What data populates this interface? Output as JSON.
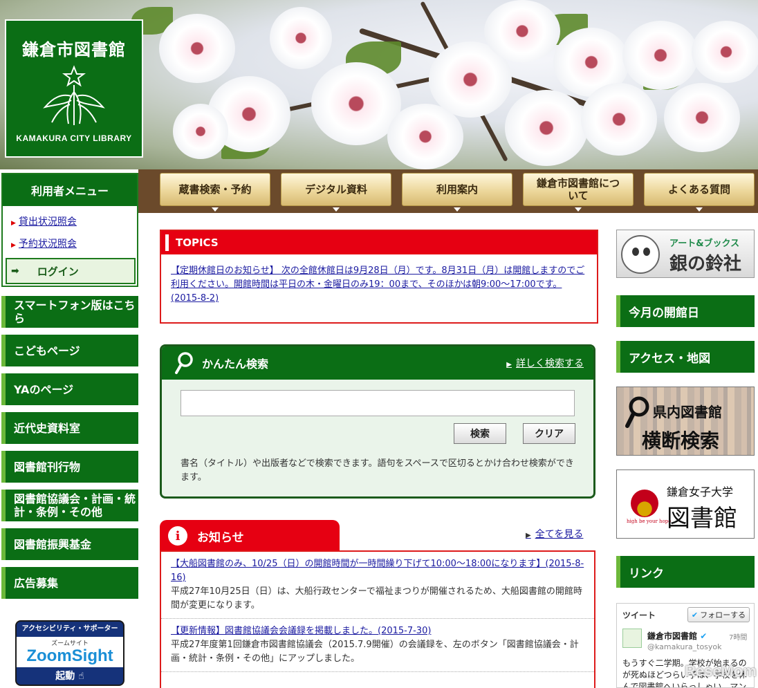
{
  "header": {
    "logo_title": "鎌倉市図書館",
    "logo_subtitle": "KAMAKURA CITY LIBRARY"
  },
  "nav": {
    "items": [
      {
        "label": "蔵書検索・予約"
      },
      {
        "label": "デジタル資料"
      },
      {
        "label": "利用案内"
      },
      {
        "label": "鎌倉市図書館について"
      },
      {
        "label": "よくある質問"
      }
    ]
  },
  "user_menu": {
    "title": "利用者メニュー",
    "links": [
      "貸出状況照会",
      "予約状況照会"
    ],
    "login_label": "ログイン"
  },
  "sidebar": {
    "items": [
      {
        "label": "スマートフォン版はこちら"
      },
      {
        "label": "こどもページ"
      },
      {
        "label": "YAのページ"
      },
      {
        "label": "近代史資料室"
      },
      {
        "label": "図書館刊行物"
      },
      {
        "label": "図書館協議会・計画・統計・条例・その他"
      },
      {
        "label": "図書館振興基金"
      },
      {
        "label": "広告募集"
      }
    ]
  },
  "zoomsight": {
    "top": "アクセシビリティ・サポーター",
    "small": "ズームサイト",
    "logo": "ZoomSight",
    "start": "起動"
  },
  "topics": {
    "title": "TOPICS",
    "body": "【定期休館日のお知らせ】 次の全館休館日は9月28日（月）です。8月31日（月）は開館しますのでご利用ください。開館時間は平日の木・金曜日のみ19：00まで、そのほかは朝9:00～17:00です。(2015-8-2)"
  },
  "search": {
    "title": "かんたん検索",
    "advanced_link": "詳しく検索する",
    "input_value": "",
    "search_button": "検索",
    "clear_button": "クリア",
    "help": "書名（タイトル）や出版者などで検索できます。語句をスペースで区切るとかけ合わせ検索ができます。"
  },
  "notices": {
    "title": "お知らせ",
    "icon_char": "i",
    "see_all": "全てを見る",
    "items": [
      {
        "link": "【大船図書館のみ、10/25（日）の開館時間が一時間繰り下げて10:00～18:00になります】(2015-8-16)",
        "text": "平成27年10月25日（日）は、大船行政センターで福祉まつりが開催されるため、大船図書館の開館時間が変更になります。"
      },
      {
        "link": "【更新情報】図書館協議会会議録を掲載しました。(2015-7-30)",
        "text": "平成27年度第1回鎌倉市図書館協議会（2015.7.9開催）の会議録を、左のボタン「図書館協議会・計画・統計・条例・その他」にアップしました。"
      }
    ]
  },
  "right": {
    "ginnosuzu_top": "アート&ブックス",
    "ginnosuzu_main": "銀の鈴社",
    "items": [
      {
        "label": "今月の開館日"
      },
      {
        "label": "アクセス・地図"
      }
    ],
    "kennai_top": "県内図書館",
    "kennai_main": "横断検索",
    "joshi_top": "鎌倉女子大学",
    "joshi_main": "図書館",
    "joshi_motto": "high be your hope",
    "link_label": "リンク"
  },
  "twitter": {
    "title": "ツイート",
    "follow": "フォローする",
    "name": "鎌倉市図書館",
    "handle": "@kamakura_tosyok",
    "time": "7時間",
    "body": "もうすぐ二学期。学校が始まるのが死ぬほどつらい子は、学校を休んで図書館へいらっしゃい。マンガも"
  },
  "watermark": "ReseMom",
  "colors": {
    "brand_green": "#0b6e15",
    "accent_red": "#e60012",
    "nav_brown": "#6b4a2b",
    "link_blue": "#1a1aa0"
  }
}
